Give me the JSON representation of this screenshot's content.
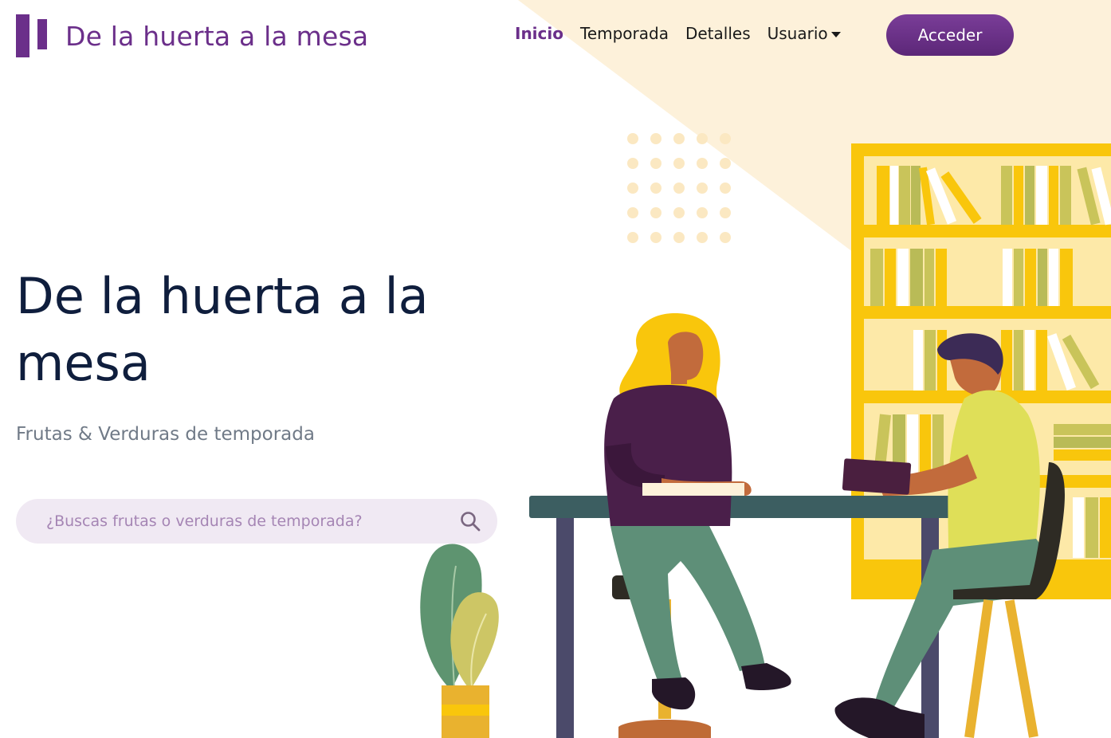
{
  "brand": {
    "name": "De la huerta a la mesa",
    "logo_icon": "brand-bars-icon",
    "color": "#6b2f8a"
  },
  "nav": {
    "items": [
      {
        "label": "Inicio",
        "active": true
      },
      {
        "label": "Temporada",
        "active": false
      },
      {
        "label": "Detalles",
        "active": false
      },
      {
        "label": "Usuario",
        "active": false,
        "dropdown": true
      }
    ],
    "login_button": "Acceder"
  },
  "hero": {
    "title": "De la huerta a la mesa",
    "subtitle": "Frutas & Verduras de temporada"
  },
  "search": {
    "placeholder": "¿Buscas frutas o verduras de temporada?",
    "value": "",
    "icon": "search-icon"
  },
  "colors": {
    "accent": "#6b2f8a",
    "title": "#0f1e3d",
    "beam": "#fdf1da",
    "shelf": "#f9c60c"
  }
}
